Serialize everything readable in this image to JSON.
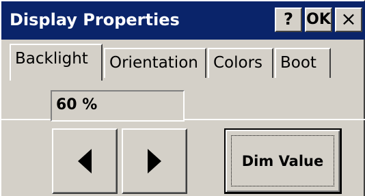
{
  "window": {
    "title": "Display Properties",
    "help_button": "?",
    "ok_button": "OK",
    "close_button": "×"
  },
  "tabs": [
    {
      "label": "Backlight",
      "active": true
    },
    {
      "label": "Orientation",
      "active": false
    },
    {
      "label": "Colors",
      "active": false
    },
    {
      "label": "Boot",
      "active": false
    }
  ],
  "backlight": {
    "value": "60 %",
    "decrease_icon": "left-arrow-icon",
    "increase_icon": "right-arrow-icon",
    "dim_button": "Dim Value"
  },
  "colors": {
    "titlebar": "#0a246a",
    "face": "#d4d0c8"
  }
}
